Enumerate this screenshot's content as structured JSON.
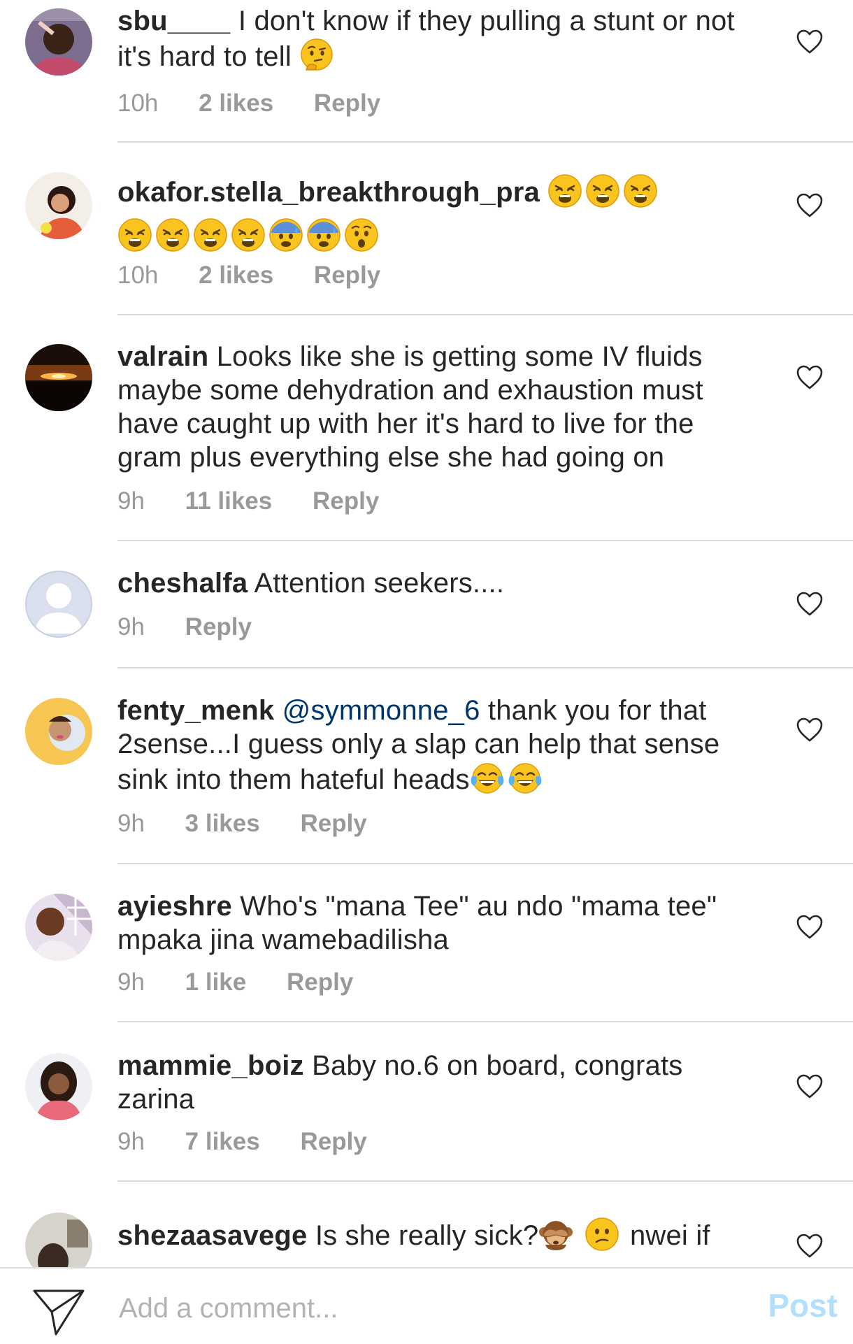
{
  "comments": [
    {
      "username": "sbu____",
      "text": "I don't know if they pulling a stunt or not it's hard to tell",
      "emojis": "thinking-face",
      "time": "10h",
      "likes": "2 likes",
      "reply": "Reply"
    },
    {
      "username": "okafor.stella_breakthrough_pra",
      "text": "",
      "emojis": "weary-face x3, weary-face x4, anxious-sweat-face x2, hushed-face",
      "time": "10h",
      "likes": "2 likes",
      "reply": "Reply"
    },
    {
      "username": "valrain",
      "text": "Looks like she is getting some IV fluids maybe some dehydration and exhaustion must have caught up with her it's hard to live for the gram plus everything else she had going on",
      "time": "9h",
      "likes": "11 likes",
      "reply": "Reply"
    },
    {
      "username": "cheshalfa",
      "text": "Attention seekers....",
      "time": "9h",
      "reply": "Reply"
    },
    {
      "username": "fenty_menk",
      "mention": "@symmonne_6",
      "text": "thank you for that 2sense...I guess only a slap can help that sense sink into them hateful heads",
      "emojis": "tears-of-joy-face x2",
      "time": "9h",
      "likes": "3 likes",
      "reply": "Reply"
    },
    {
      "username": "ayieshre",
      "text": "Who's \"mana Tee\" au ndo \"mama tee\" mpaka jina wamebadilisha",
      "time": "9h",
      "likes": "1 like",
      "reply": "Reply"
    },
    {
      "username": "mammie_boiz",
      "text": "Baby no.6 on board, congrats zarina",
      "time": "9h",
      "likes": "7 likes",
      "reply": "Reply"
    },
    {
      "username": "shezaasavege",
      "text": "Is she really sick?",
      "emojis": "see-no-evil-monkey, confused-face",
      "text_after": "nwei if"
    }
  ],
  "composer": {
    "placeholder": "Add a comment...",
    "post_label": "Post",
    "send_icon": "paper-plane-icon"
  },
  "colors": {
    "username": "#262626",
    "meta": "#999999",
    "mention": "#003569",
    "post_disabled": "#b2dffc",
    "divider": "#dbdbdb"
  }
}
